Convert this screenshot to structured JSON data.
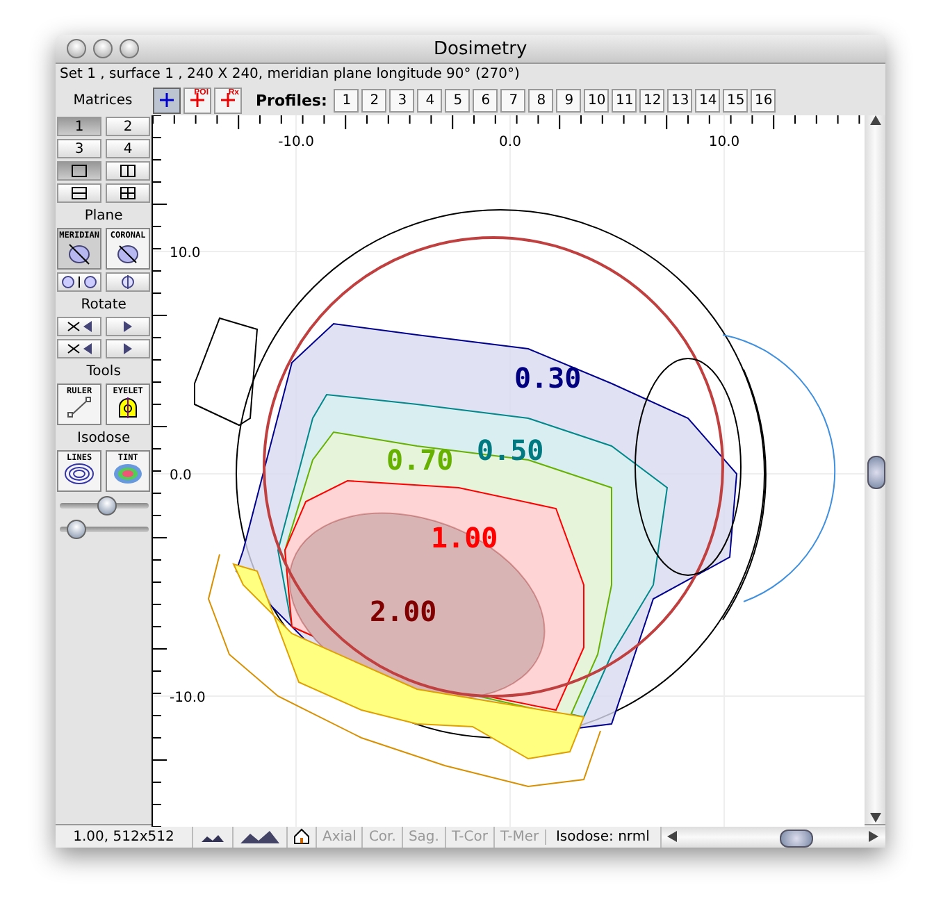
{
  "window": {
    "title": "Dosimetry"
  },
  "info_line": "Set 1 , surface 1 , 240 X 240, meridian plane longitude 90° (270°)",
  "toolbar": {
    "tools": [
      {
        "kind": "cross",
        "selected": true
      },
      {
        "kind": "cross-label",
        "label": "POI",
        "selected": false
      },
      {
        "kind": "cross-label",
        "label": "Rx",
        "selected": false
      }
    ],
    "profiles_label": "Profiles:",
    "profiles": [
      "1",
      "2",
      "3",
      "4",
      "5",
      "6",
      "7",
      "8",
      "9",
      "10",
      "11",
      "12",
      "13",
      "14",
      "15",
      "16"
    ]
  },
  "sidebar": {
    "matrices_label": "Matrices",
    "matrices": [
      {
        "label": "1",
        "selected": true
      },
      {
        "label": "2",
        "selected": false
      },
      {
        "label": "3",
        "selected": false
      },
      {
        "label": "4",
        "selected": false
      }
    ],
    "layouts": [
      {
        "kind": "single",
        "selected": true
      },
      {
        "kind": "columns",
        "selected": false
      },
      {
        "kind": "rows",
        "selected": false
      },
      {
        "kind": "quad",
        "selected": false
      }
    ],
    "plane_label": "Plane",
    "planes": [
      {
        "label": "MERIDIAN",
        "selected": true
      },
      {
        "label": "CORONAL",
        "selected": false
      }
    ],
    "rotate_label": "Rotate",
    "tools_label": "Tools",
    "tools": [
      {
        "kind": "ruler",
        "label": "RULER"
      },
      {
        "kind": "eyelet",
        "label": "EYELET"
      }
    ],
    "isodose_label": "Isodose",
    "isodose_modes": [
      {
        "kind": "lines",
        "label": "LINES"
      },
      {
        "kind": "tint",
        "label": "TINT"
      }
    ],
    "sliders": [
      {
        "level": 0.55
      },
      {
        "level": 0.1
      }
    ]
  },
  "plot": {
    "x_ticks": [
      {
        "label": "-10.0"
      },
      {
        "label": "0.0"
      },
      {
        "label": "10.0"
      }
    ],
    "y_ticks": [
      {
        "label": "10.0"
      },
      {
        "label": "0.0"
      },
      {
        "label": "-10.0"
      }
    ],
    "isodose_labels": [
      {
        "text": "0.30",
        "color": "#000080"
      },
      {
        "text": "0.50",
        "color": "#007a80"
      },
      {
        "text": "0.70",
        "color": "#66b000"
      },
      {
        "text": "1.00",
        "color": "#ff0000"
      },
      {
        "text": "2.00",
        "color": "#800000"
      }
    ]
  },
  "status_bar": {
    "zoom": "1.00, 512x512",
    "views": [
      {
        "label": "Axial",
        "disabled": true
      },
      {
        "label": "Cor.",
        "disabled": true
      },
      {
        "label": "Sag.",
        "disabled": true
      },
      {
        "label": "T-Cor",
        "disabled": true
      },
      {
        "label": "T-Mer",
        "disabled": true
      }
    ],
    "isodose": "Isodose: nrml"
  }
}
